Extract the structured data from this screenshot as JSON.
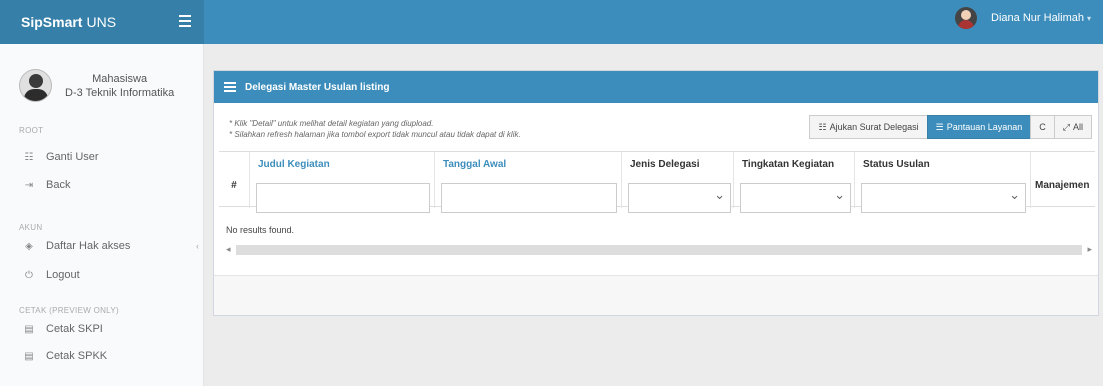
{
  "app": {
    "brand_bold": "SipSmart",
    "brand_rest": "UNS"
  },
  "header": {
    "user_name": "Diana Nur Halimah"
  },
  "sidebar": {
    "profile": {
      "role": "Mahasiswa",
      "program": "D-3 Teknik Informatika"
    },
    "sections": [
      {
        "title": "ROOT",
        "items": [
          {
            "label": "Ganti User",
            "icon": "users-icon"
          },
          {
            "label": "Back",
            "icon": "sign-in-icon"
          }
        ]
      },
      {
        "title": "AKUN",
        "items": [
          {
            "label": "Daftar Hak akses",
            "icon": "shield-icon"
          },
          {
            "label": "Logout",
            "icon": "power-icon"
          }
        ]
      },
      {
        "title": "CETAK (PREVIEW ONLY)",
        "items": [
          {
            "label": "Cetak SKPI",
            "icon": "file-icon"
          },
          {
            "label": "Cetak SPKK",
            "icon": "file-icon"
          }
        ]
      }
    ]
  },
  "box": {
    "title": "Delegasi Master Usulan listing",
    "notes": [
      "* Klik \"Detail\" untuk melihat detail kegiatan yang diupload.",
      "* Silahkan refresh halaman jika tombol export tidak muncul atau tidak dapat di klik."
    ],
    "buttons": {
      "ajukan": "Ajukan Surat Delegasi",
      "pantauan": "Pantauan Layanan",
      "refresh": "C",
      "all": "All"
    },
    "table": {
      "hash": "#",
      "columns": [
        "Judul Kegiatan",
        "Tanggal Awal",
        "Jenis Delegasi",
        "Tingkatan Kegiatan",
        "Status Usulan",
        "Manajemen"
      ]
    },
    "empty_text": "No results found."
  },
  "colors": {
    "primary": "#3c8dbc",
    "brand_dark": "#367fa9"
  }
}
